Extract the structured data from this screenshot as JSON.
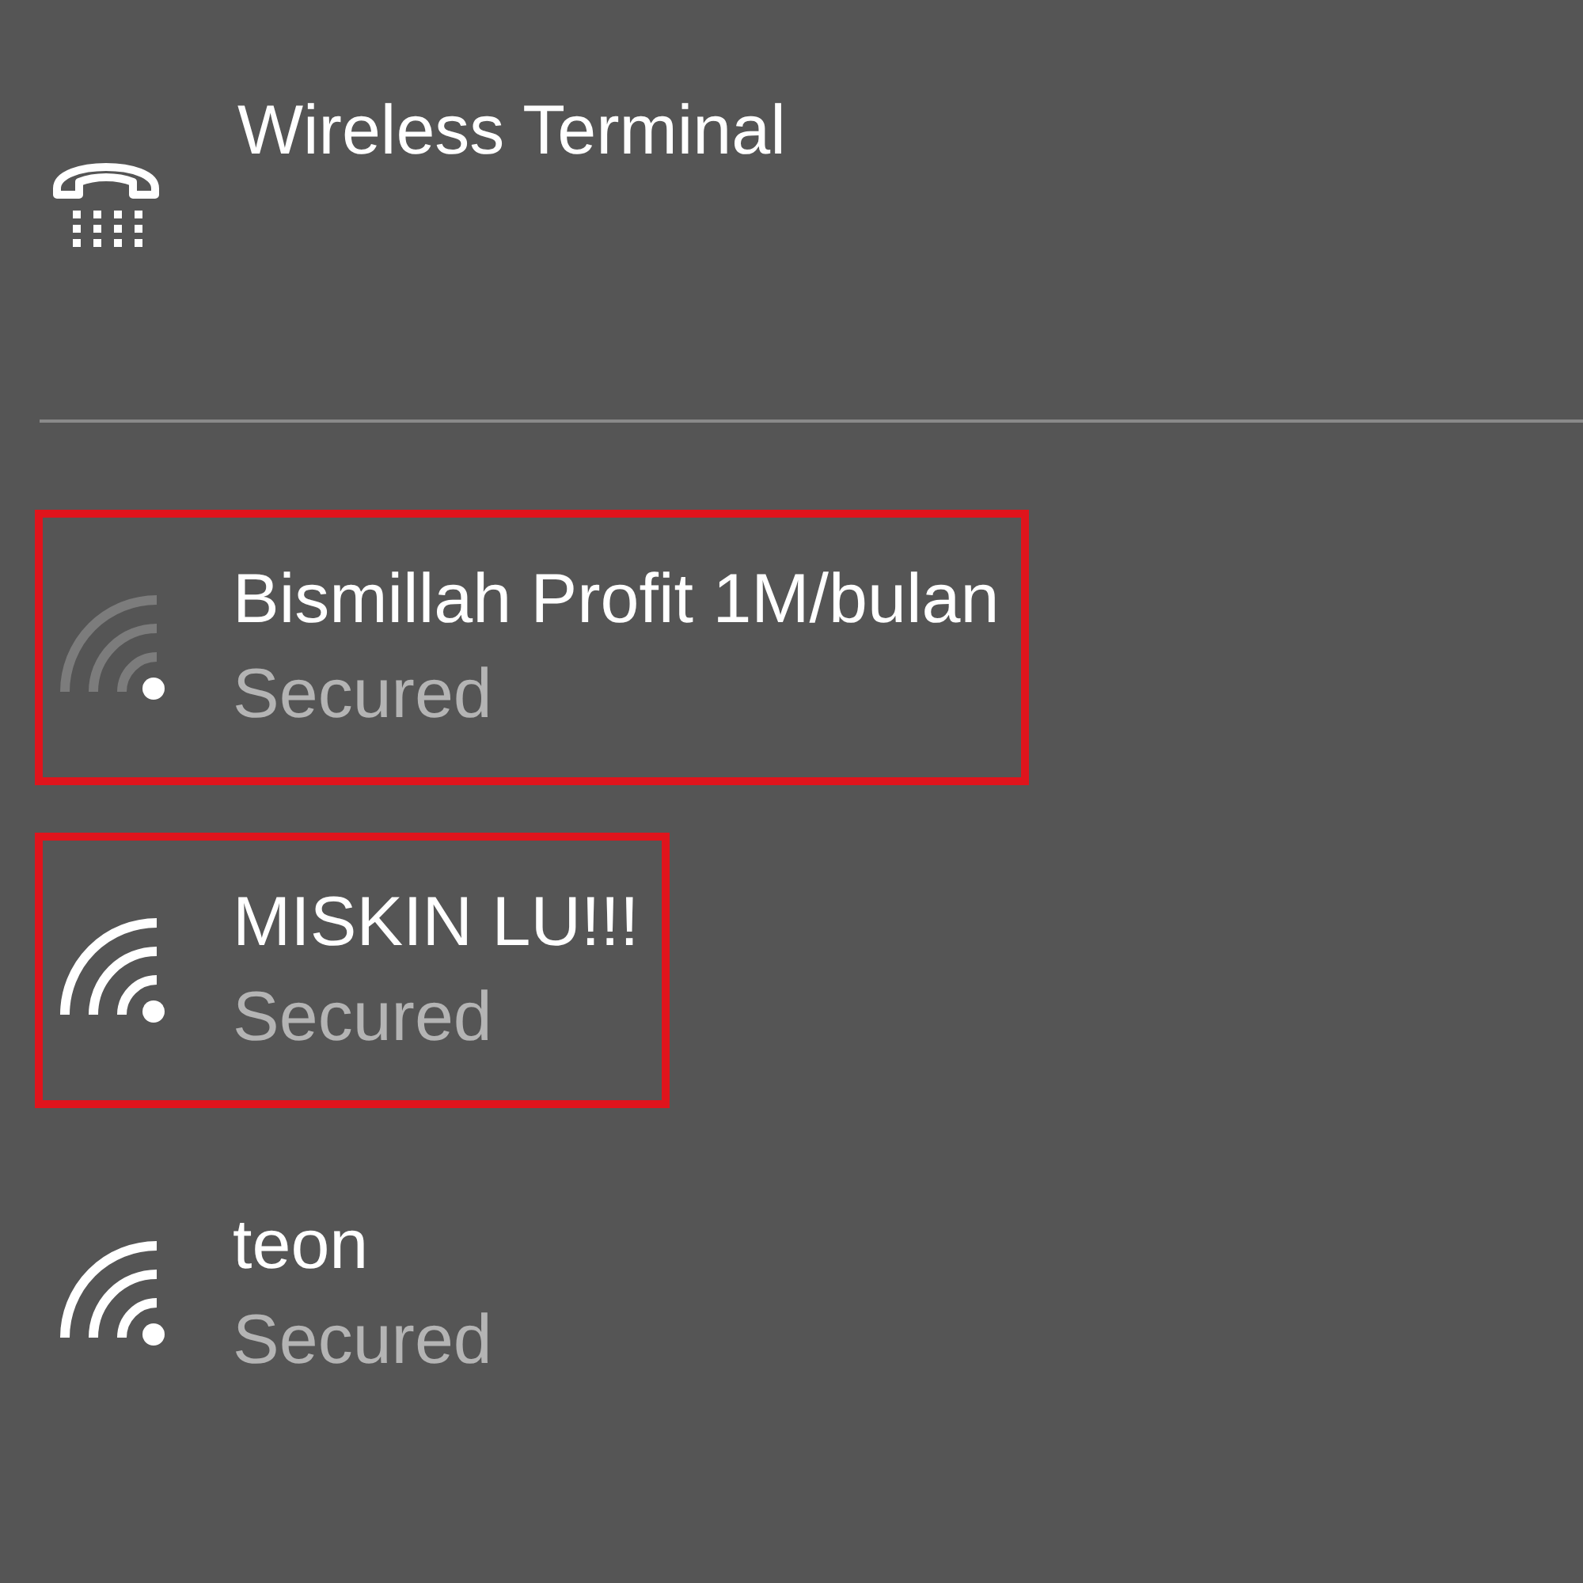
{
  "connection": {
    "name": "Wireless Terminal"
  },
  "networks": [
    {
      "name": "Bismillah Profit 1M/bulan",
      "status": "Secured",
      "kind": "weak",
      "highlighted": true
    },
    {
      "name": "MISKIN LU!!!",
      "status": "Secured",
      "kind": "strong",
      "highlighted": true
    },
    {
      "name": "teon",
      "status": "Secured",
      "kind": "strong",
      "highlighted": false
    }
  ]
}
